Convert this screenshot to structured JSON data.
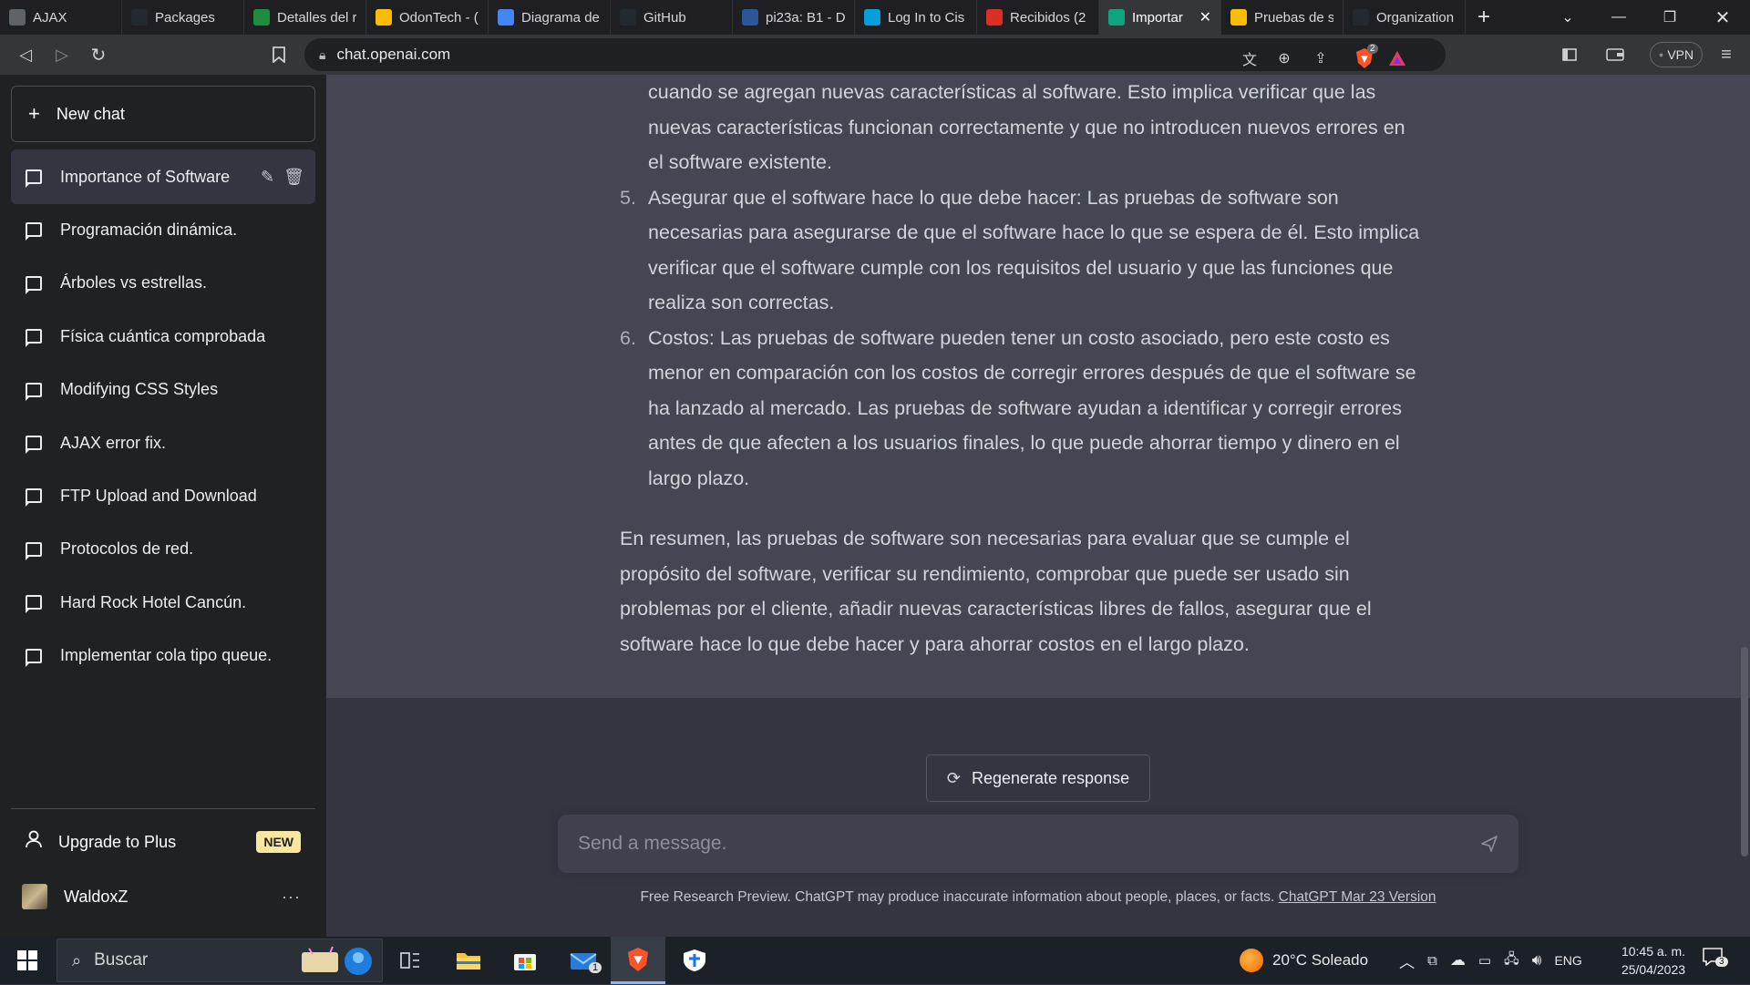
{
  "browser": {
    "tabs": [
      {
        "label": "AJAX",
        "icon": "globe-icon",
        "color": "#5f6368"
      },
      {
        "label": "Packages",
        "icon": "github-icon",
        "color": "#24292f"
      },
      {
        "label": "Detalles del r",
        "icon": "classroom-icon",
        "color": "#1e8e3e"
      },
      {
        "label": "OdonTech - (",
        "icon": "drive-icon",
        "color": "#fbbc04"
      },
      {
        "label": "Diagrama de",
        "icon": "docs-icon",
        "color": "#4285f4"
      },
      {
        "label": "GitHub",
        "icon": "github-icon",
        "color": "#24292f"
      },
      {
        "label": "pi23a: B1 - D",
        "icon": "teams-icon",
        "color": "#2b579a"
      },
      {
        "label": "Log In to Cis",
        "icon": "cisco-icon",
        "color": "#049fd9"
      },
      {
        "label": "Recibidos (2",
        "icon": "gmail-icon",
        "color": "#d93025"
      },
      {
        "label": "Importar",
        "icon": "openai-icon",
        "color": "#10a37f",
        "active": true
      },
      {
        "label": "Pruebas de s",
        "icon": "slides-icon",
        "color": "#fbbc04"
      },
      {
        "label": "Organization",
        "icon": "github-icon",
        "color": "#24292f"
      }
    ],
    "new_tab": "+",
    "url": "chat.openai.com",
    "vpn_label": "VPN",
    "brave_badge": "2"
  },
  "sidebar": {
    "new_chat": "New chat",
    "conversations": [
      "Importance of Software",
      "Programación dinámica.",
      "Árboles vs estrellas.",
      "Física cuántica comprobada",
      "Modifying CSS Styles",
      "AJAX error fix.",
      "FTP Upload and Download",
      "Protocolos de red.",
      "Hard Rock Hotel Cancún.",
      "Implementar cola tipo queue."
    ],
    "upgrade": "Upgrade to Plus",
    "upgrade_badge": "NEW",
    "username": "WaldoxZ"
  },
  "answer": {
    "item4_cont": [
      "cuando se agregan nuevas características al software. Esto implica verificar que las",
      "nuevas características funcionan correctamente y que no introducen nuevos errores en",
      "el software existente."
    ],
    "items": [
      {
        "num": "5.",
        "lines": [
          "Asegurar que el software hace lo que debe hacer: Las pruebas de software son",
          "necesarias para asegurarse de que el software hace lo que se espera de él. Esto implica",
          "verificar que el software cumple con los requisitos del usuario y que las funciones que",
          "realiza son correctas."
        ]
      },
      {
        "num": "6.",
        "lines": [
          "Costos: Las pruebas de software pueden tener un costo asociado, pero este costo es",
          "menor en comparación con los costos de corregir errores después de que el software se",
          "ha lanzado al mercado. Las pruebas de software ayudan a identificar y corregir errores",
          "antes de que afecten a los usuarios finales, lo que puede ahorrar tiempo y dinero en el",
          "largo plazo."
        ]
      }
    ],
    "summary": [
      "En resumen, las pruebas de software son necesarias para evaluar que se cumple el",
      "propósito del software, verificar su rendimiento, comprobar que puede ser usado sin",
      "problemas por el cliente, añadir nuevas características libres de fallos, asegurar que el",
      "software hace lo que debe hacer y para ahorrar costos en el largo plazo."
    ]
  },
  "composer": {
    "regenerate": "Regenerate response",
    "placeholder": "Send a message.",
    "disclaimer": "Free Research Preview. ChatGPT may produce inaccurate information about people, places, or facts. ",
    "version_link": "ChatGPT Mar 23 Version"
  },
  "taskbar": {
    "search_placeholder": "Buscar",
    "mail_badge": "1",
    "weather": "20°C  Soleado",
    "lang": "ENG",
    "time": "10:45 a. m.",
    "date": "25/04/2023",
    "notifications": "3"
  }
}
